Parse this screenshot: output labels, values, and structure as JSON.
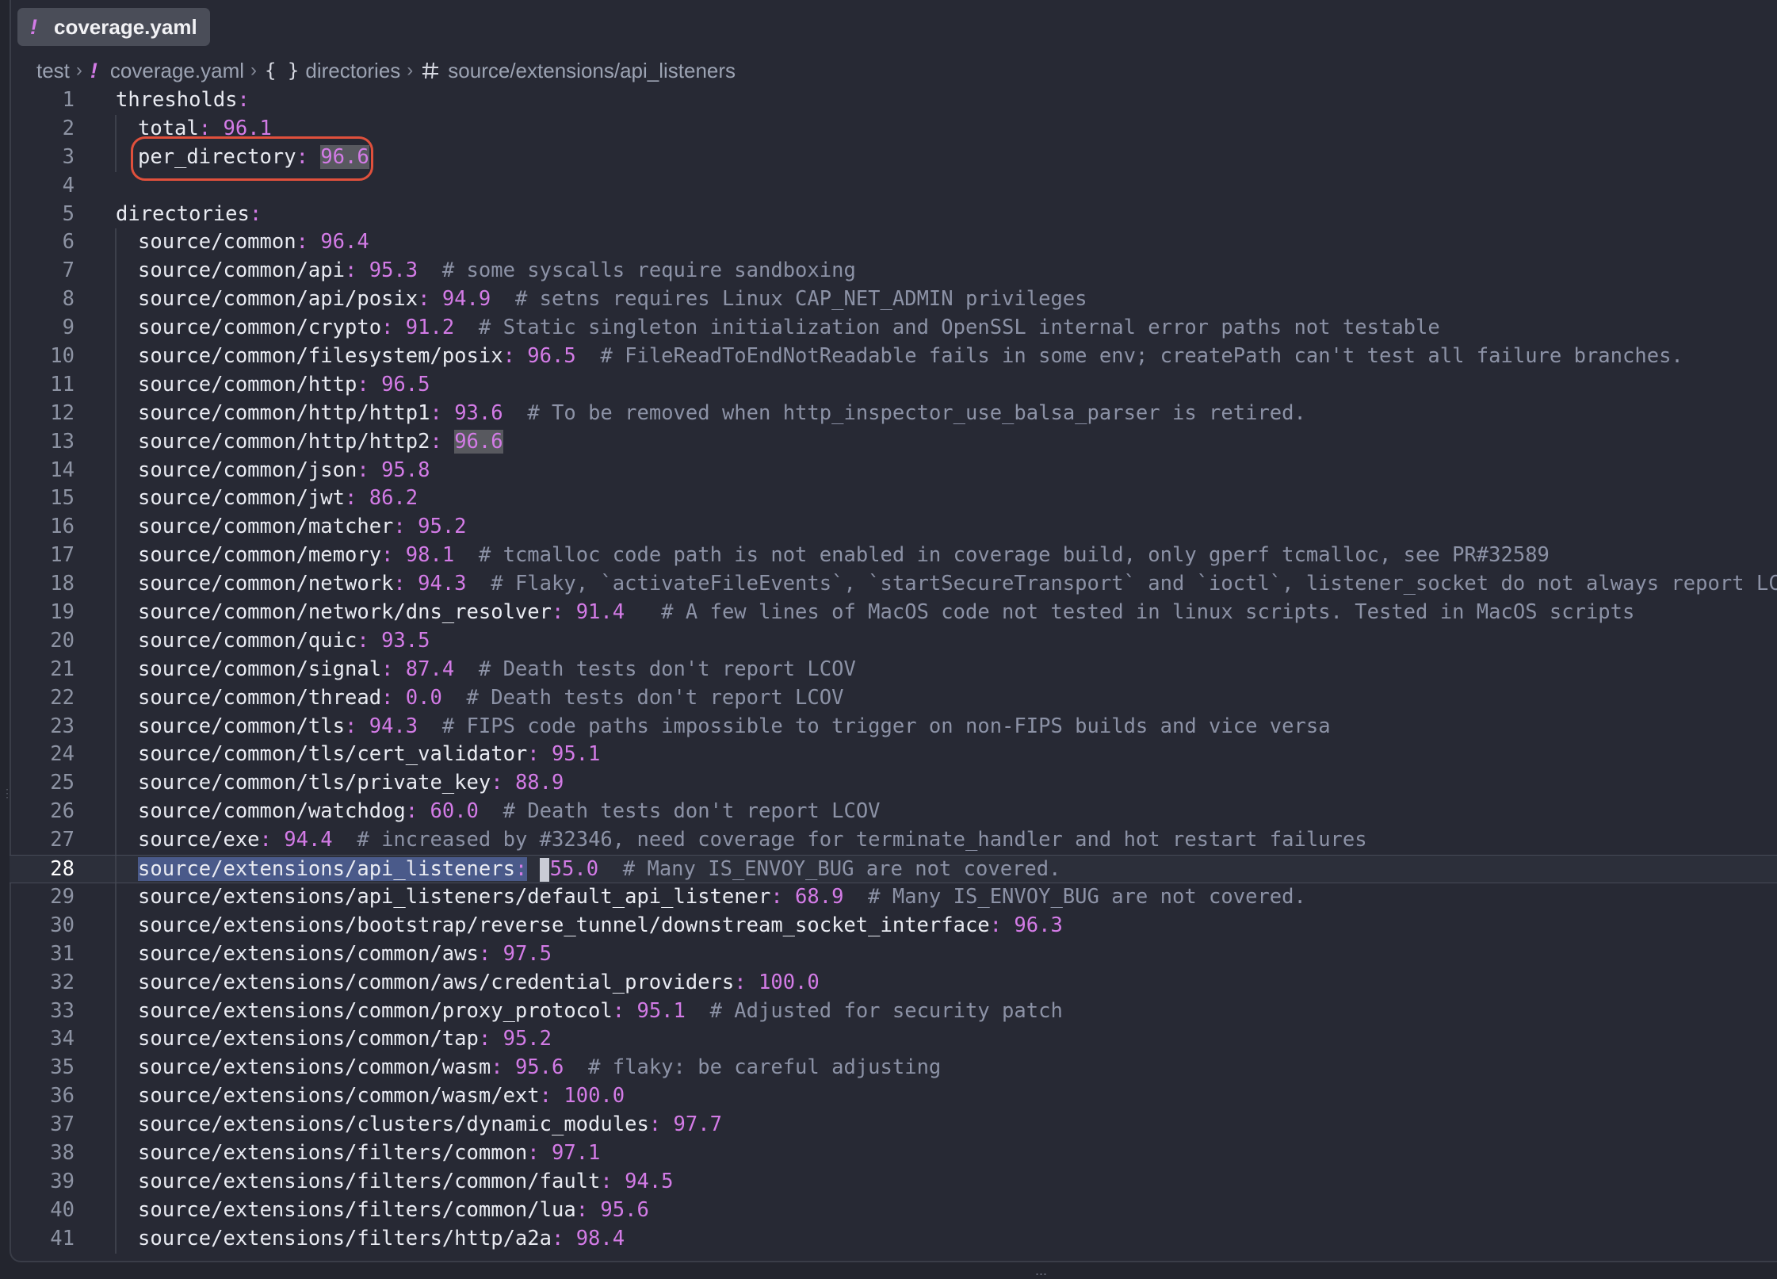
{
  "tab": {
    "icon": "yaml-file-icon",
    "bang": "!",
    "label": "coverage.yaml"
  },
  "breadcrumb": {
    "items": [
      "test",
      "coverage.yaml",
      "directories",
      "source/extensions/api_listeners"
    ],
    "icons": {
      "file": "!",
      "object": "{ }",
      "key": "hash-icon"
    }
  },
  "editor": {
    "current_line": 28,
    "lines": [
      {
        "n": "1",
        "key": "thresholds",
        "colon": ":",
        "indent": 0
      },
      {
        "n": "2",
        "key": "total",
        "colon": ":",
        "value": "96.1",
        "indent": 1
      },
      {
        "n": "3",
        "key": "per_directory",
        "colon": ":",
        "value": "96.6",
        "indent": 1
      },
      {
        "n": "4"
      },
      {
        "n": "5",
        "key": "directories",
        "colon": ":",
        "indent": 0
      },
      {
        "n": "6",
        "key": "source/common",
        "colon": ":",
        "value": "96.4",
        "indent": 1
      },
      {
        "n": "7",
        "key": "source/common/api",
        "colon": ":",
        "value": "95.3",
        "comment": "  # some syscalls require sandboxing",
        "indent": 1
      },
      {
        "n": "8",
        "key": "source/common/api/posix",
        "colon": ":",
        "value": "94.9",
        "comment": "  # setns requires Linux CAP_NET_ADMIN privileges",
        "indent": 1
      },
      {
        "n": "9",
        "key": "source/common/crypto",
        "colon": ":",
        "value": "91.2",
        "comment": "  # Static singleton initialization and OpenSSL internal error paths not testable",
        "indent": 1
      },
      {
        "n": "10",
        "key": "source/common/filesystem/posix",
        "colon": ":",
        "value": "96.5",
        "comment": "  # FileReadToEndNotReadable fails in some env; createPath can't test all failure branches.",
        "indent": 1
      },
      {
        "n": "11",
        "key": "source/common/http",
        "colon": ":",
        "value": "96.5",
        "indent": 1
      },
      {
        "n": "12",
        "key": "source/common/http/http1",
        "colon": ":",
        "value": "93.6",
        "comment": "  # To be removed when http_inspector_use_balsa_parser is retired.",
        "indent": 1
      },
      {
        "n": "13",
        "key": "source/common/http/http2",
        "colon": ":",
        "value": "96.6",
        "indent": 1
      },
      {
        "n": "14",
        "key": "source/common/json",
        "colon": ":",
        "value": "95.8",
        "indent": 1
      },
      {
        "n": "15",
        "key": "source/common/jwt",
        "colon": ":",
        "value": "86.2",
        "indent": 1
      },
      {
        "n": "16",
        "key": "source/common/matcher",
        "colon": ":",
        "value": "95.2",
        "indent": 1
      },
      {
        "n": "17",
        "key": "source/common/memory",
        "colon": ":",
        "value": "98.1",
        "comment": "  # tcmalloc code path is not enabled in coverage build, only gperf tcmalloc, see PR#32589",
        "indent": 1
      },
      {
        "n": "18",
        "key": "source/common/network",
        "colon": ":",
        "value": "94.3",
        "comment": "  # Flaky, `activateFileEvents`, `startSecureTransport` and `ioctl`, listener_socket do not always report LCOV",
        "indent": 1
      },
      {
        "n": "19",
        "key": "source/common/network/dns_resolver",
        "colon": ":",
        "value": "91.4",
        "comment": "   # A few lines of MacOS code not tested in linux scripts. Tested in MacOS scripts",
        "indent": 1
      },
      {
        "n": "20",
        "key": "source/common/quic",
        "colon": ":",
        "value": "93.5",
        "indent": 1
      },
      {
        "n": "21",
        "key": "source/common/signal",
        "colon": ":",
        "value": "87.4",
        "comment": "  # Death tests don't report LCOV",
        "indent": 1
      },
      {
        "n": "22",
        "key": "source/common/thread",
        "colon": ":",
        "value": "0.0",
        "comment": "  # Death tests don't report LCOV",
        "indent": 1
      },
      {
        "n": "23",
        "key": "source/common/tls",
        "colon": ":",
        "value": "94.3",
        "comment": "  # FIPS code paths impossible to trigger on non-FIPS builds and vice versa",
        "indent": 1
      },
      {
        "n": "24",
        "key": "source/common/tls/cert_validator",
        "colon": ":",
        "value": "95.1",
        "indent": 1
      },
      {
        "n": "25",
        "key": "source/common/tls/private_key",
        "colon": ":",
        "value": "88.9",
        "indent": 1
      },
      {
        "n": "26",
        "key": "source/common/watchdog",
        "colon": ":",
        "value": "60.0",
        "comment": "  # Death tests don't report LCOV",
        "indent": 1
      },
      {
        "n": "27",
        "key": "source/exe",
        "colon": ":",
        "value": "94.4",
        "comment": "  # increased by #32346, need coverage for terminate_handler and hot restart failures",
        "indent": 1
      },
      {
        "n": "28",
        "key": "source/extensions/api_listeners",
        "colon": ":",
        "value": "55.0",
        "comment": "  # Many IS_ENVOY_BUG are not covered.",
        "indent": 1
      },
      {
        "n": "29",
        "key": "source/extensions/api_listeners/default_api_listener",
        "colon": ":",
        "value": "68.9",
        "comment": "  # Many IS_ENVOY_BUG are not covered.",
        "indent": 1
      },
      {
        "n": "30",
        "key": "source/extensions/bootstrap/reverse_tunnel/downstream_socket_interface",
        "colon": ":",
        "value": "96.3",
        "indent": 1
      },
      {
        "n": "31",
        "key": "source/extensions/common/aws",
        "colon": ":",
        "value": "97.5",
        "indent": 1
      },
      {
        "n": "32",
        "key": "source/extensions/common/aws/credential_providers",
        "colon": ":",
        "value": "100.0",
        "indent": 1
      },
      {
        "n": "33",
        "key": "source/extensions/common/proxy_protocol",
        "colon": ":",
        "value": "95.1",
        "comment": "  # Adjusted for security patch",
        "indent": 1
      },
      {
        "n": "34",
        "key": "source/extensions/common/tap",
        "colon": ":",
        "value": "95.2",
        "indent": 1
      },
      {
        "n": "35",
        "key": "source/extensions/common/wasm",
        "colon": ":",
        "value": "95.6",
        "comment": "  # flaky: be careful adjusting",
        "indent": 1
      },
      {
        "n": "36",
        "key": "source/extensions/common/wasm/ext",
        "colon": ":",
        "value": "100.0",
        "indent": 1
      },
      {
        "n": "37",
        "key": "source/extensions/clusters/dynamic_modules",
        "colon": ":",
        "value": "97.7",
        "indent": 1
      },
      {
        "n": "38",
        "key": "source/extensions/filters/common",
        "colon": ":",
        "value": "97.1",
        "indent": 1
      },
      {
        "n": "39",
        "key": "source/extensions/filters/common/fault",
        "colon": ":",
        "value": "94.5",
        "indent": 1
      },
      {
        "n": "40",
        "key": "source/extensions/filters/common/lua",
        "colon": ":",
        "value": "95.6",
        "indent": 1
      },
      {
        "n": "41",
        "key": "source/extensions/filters/http/a2a",
        "colon": ":",
        "value": "98.4",
        "indent": 1
      }
    ]
  },
  "status": {
    "scroll_indicator": "...",
    "sash": "⋮"
  },
  "colors": {
    "accent": "#d37be6",
    "annotation": "#e0503c",
    "background": "#272934"
  }
}
